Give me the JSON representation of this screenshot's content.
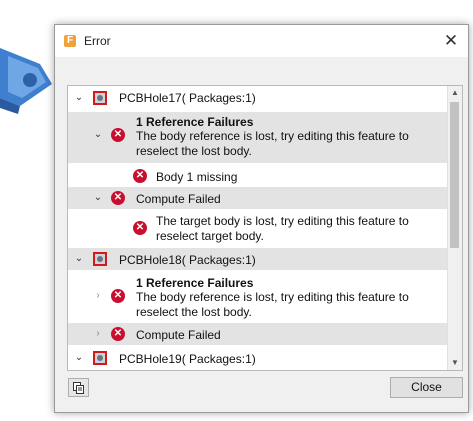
{
  "dialog": {
    "title": "Error",
    "close_button_label": "Close"
  },
  "tree": {
    "items": [
      {
        "label": "PCBHole17( Packages:1)"
      },
      {
        "header": "1 Reference Failures",
        "message": "The body reference is lost, try editing this feature to reselect the lost body."
      },
      {
        "label": "Body 1 missing"
      },
      {
        "label": "Compute Failed"
      },
      {
        "message": "The target body is lost, try editing this feature to reselect target body."
      },
      {
        "label": "PCBHole18( Packages:1)"
      },
      {
        "header": "1 Reference Failures",
        "message": "The body reference is lost, try editing this feature to reselect the lost body."
      },
      {
        "label": "Compute Failed"
      },
      {
        "label": "PCBHole19( Packages:1)"
      }
    ]
  },
  "icons": {
    "app": "fusion-app-icon",
    "close": "close-icon",
    "error": "error-icon",
    "hole": "pcb-hole-icon",
    "copy": "copy-icon"
  },
  "colors": {
    "error_red": "#c8102e",
    "row_shade": "#e3e3e3",
    "dialog_bg": "#f0f0f0"
  }
}
